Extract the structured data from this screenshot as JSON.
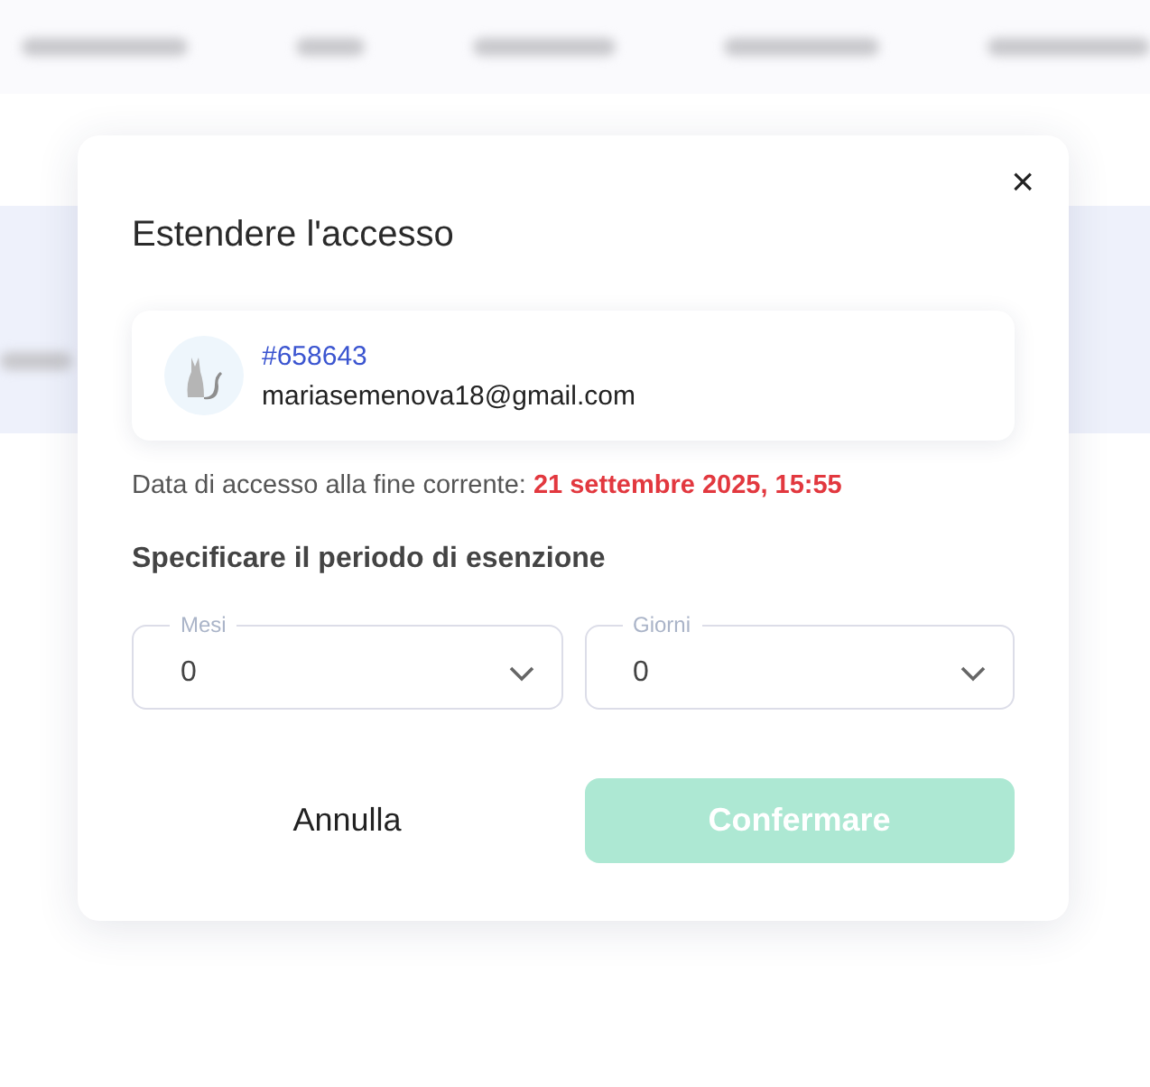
{
  "dialog": {
    "title": "Estendere l'accesso",
    "close_label": "×",
    "user": {
      "id": "#658643",
      "email": "mariasemenova18@gmail.com"
    },
    "access_end": {
      "label": "Data di accesso alla fine corrente:",
      "value": "21 settembre 2025, 15:55"
    },
    "period_heading": "Specificare il periodo di esenzione",
    "selects": [
      {
        "label": "Mesi",
        "value": "0"
      },
      {
        "label": "Giorni",
        "value": "0"
      }
    ],
    "buttons": [
      {
        "label": "Annulla",
        "kind": "text",
        "disabled": false
      },
      {
        "label": "Confermare",
        "kind": "primary",
        "disabled": true
      }
    ]
  }
}
